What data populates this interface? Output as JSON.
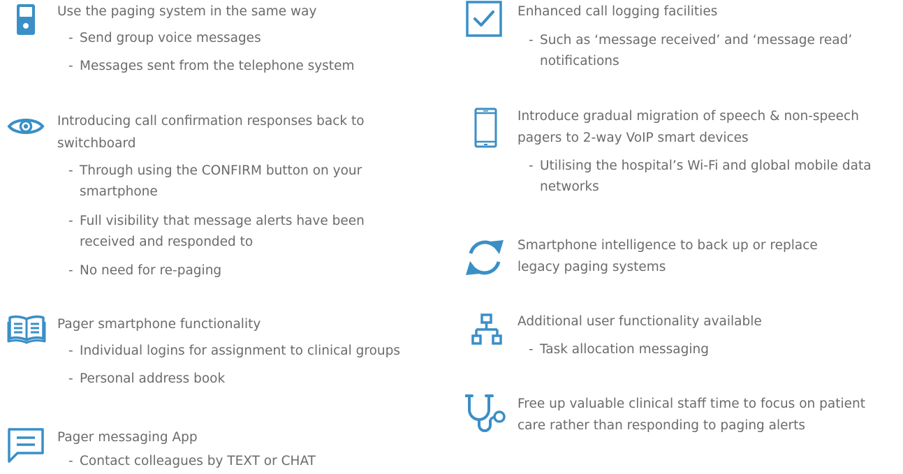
{
  "left_column": [
    {
      "icon": "pager-icon",
      "title": "Use the paging system in the same way",
      "points": [
        "Send group voice messages",
        "Messages sent from the telephone system"
      ]
    },
    {
      "icon": "eye-icon",
      "title_line1": "Introducing call confirmation responses back to",
      "title_line2": "switchboard",
      "points": [
        "Through using the CONFIRM button on your smartphone",
        "Full visibility that message alerts have been received and responded to",
        "No need for re-paging"
      ]
    },
    {
      "icon": "book-icon",
      "title": "Pager smartphone functionality",
      "points": [
        "Individual logins for assignment to clinical groups",
        "Personal address book"
      ]
    },
    {
      "icon": "chat-bubble-icon",
      "title": "Pager messaging App",
      "points": [
        "Contact colleagues by TEXT or CHAT"
      ]
    }
  ],
  "right_column": [
    {
      "icon": "checkbox-icon",
      "title": "Enhanced call logging facilities",
      "points": [
        "Such as ‘message received’ and ‘message read’ notifications"
      ]
    },
    {
      "icon": "smartphone-icon",
      "title_line1": "Introduce gradual migration of speech & non-speech",
      "title_line2": "pagers to 2-way VoIP smart devices",
      "points": [
        "Utilising the hospital’s Wi-Fi and global mobile data networks"
      ]
    },
    {
      "icon": "sync-icon",
      "title_line1": "Smartphone intelligence to back up or replace",
      "title_line2": "legacy paging systems",
      "points": []
    },
    {
      "icon": "network-icon",
      "title": "Additional user functionality available",
      "points": [
        "Task allocation messaging"
      ]
    },
    {
      "icon": "stethoscope-icon",
      "title_line1": "Free up valuable clinical staff time to focus on patient",
      "title_line2": "care rather than responding to paging alerts",
      "points": []
    }
  ],
  "dash": "-",
  "colors": {
    "icon_blue": "#3a8fc7",
    "text_gray": "#6b6b6b"
  }
}
